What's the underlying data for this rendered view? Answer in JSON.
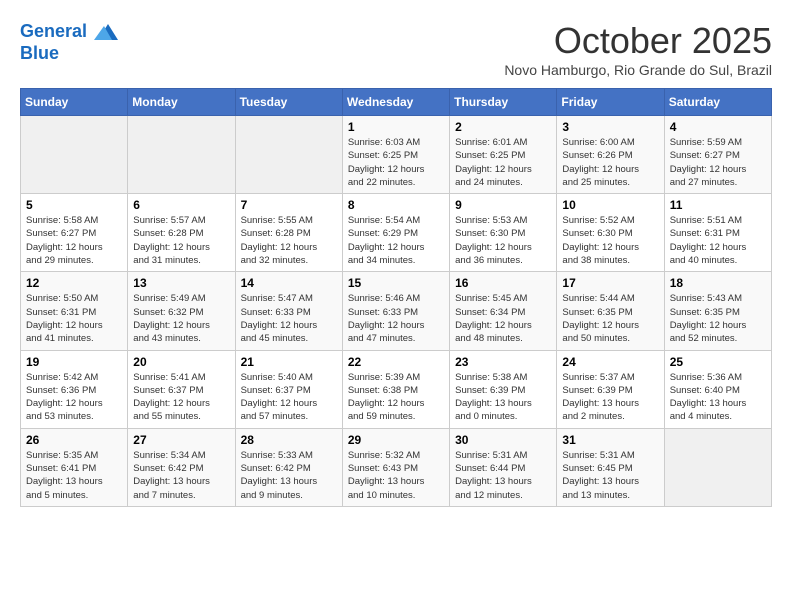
{
  "header": {
    "logo_line1": "General",
    "logo_line2": "Blue",
    "month_title": "October 2025",
    "location": "Novo Hamburgo, Rio Grande do Sul, Brazil"
  },
  "weekdays": [
    "Sunday",
    "Monday",
    "Tuesday",
    "Wednesday",
    "Thursday",
    "Friday",
    "Saturday"
  ],
  "weeks": [
    [
      {
        "day": "",
        "info": ""
      },
      {
        "day": "",
        "info": ""
      },
      {
        "day": "",
        "info": ""
      },
      {
        "day": "1",
        "info": "Sunrise: 6:03 AM\nSunset: 6:25 PM\nDaylight: 12 hours\nand 22 minutes."
      },
      {
        "day": "2",
        "info": "Sunrise: 6:01 AM\nSunset: 6:25 PM\nDaylight: 12 hours\nand 24 minutes."
      },
      {
        "day": "3",
        "info": "Sunrise: 6:00 AM\nSunset: 6:26 PM\nDaylight: 12 hours\nand 25 minutes."
      },
      {
        "day": "4",
        "info": "Sunrise: 5:59 AM\nSunset: 6:27 PM\nDaylight: 12 hours\nand 27 minutes."
      }
    ],
    [
      {
        "day": "5",
        "info": "Sunrise: 5:58 AM\nSunset: 6:27 PM\nDaylight: 12 hours\nand 29 minutes."
      },
      {
        "day": "6",
        "info": "Sunrise: 5:57 AM\nSunset: 6:28 PM\nDaylight: 12 hours\nand 31 minutes."
      },
      {
        "day": "7",
        "info": "Sunrise: 5:55 AM\nSunset: 6:28 PM\nDaylight: 12 hours\nand 32 minutes."
      },
      {
        "day": "8",
        "info": "Sunrise: 5:54 AM\nSunset: 6:29 PM\nDaylight: 12 hours\nand 34 minutes."
      },
      {
        "day": "9",
        "info": "Sunrise: 5:53 AM\nSunset: 6:30 PM\nDaylight: 12 hours\nand 36 minutes."
      },
      {
        "day": "10",
        "info": "Sunrise: 5:52 AM\nSunset: 6:30 PM\nDaylight: 12 hours\nand 38 minutes."
      },
      {
        "day": "11",
        "info": "Sunrise: 5:51 AM\nSunset: 6:31 PM\nDaylight: 12 hours\nand 40 minutes."
      }
    ],
    [
      {
        "day": "12",
        "info": "Sunrise: 5:50 AM\nSunset: 6:31 PM\nDaylight: 12 hours\nand 41 minutes."
      },
      {
        "day": "13",
        "info": "Sunrise: 5:49 AM\nSunset: 6:32 PM\nDaylight: 12 hours\nand 43 minutes."
      },
      {
        "day": "14",
        "info": "Sunrise: 5:47 AM\nSunset: 6:33 PM\nDaylight: 12 hours\nand 45 minutes."
      },
      {
        "day": "15",
        "info": "Sunrise: 5:46 AM\nSunset: 6:33 PM\nDaylight: 12 hours\nand 47 minutes."
      },
      {
        "day": "16",
        "info": "Sunrise: 5:45 AM\nSunset: 6:34 PM\nDaylight: 12 hours\nand 48 minutes."
      },
      {
        "day": "17",
        "info": "Sunrise: 5:44 AM\nSunset: 6:35 PM\nDaylight: 12 hours\nand 50 minutes."
      },
      {
        "day": "18",
        "info": "Sunrise: 5:43 AM\nSunset: 6:35 PM\nDaylight: 12 hours\nand 52 minutes."
      }
    ],
    [
      {
        "day": "19",
        "info": "Sunrise: 5:42 AM\nSunset: 6:36 PM\nDaylight: 12 hours\nand 53 minutes."
      },
      {
        "day": "20",
        "info": "Sunrise: 5:41 AM\nSunset: 6:37 PM\nDaylight: 12 hours\nand 55 minutes."
      },
      {
        "day": "21",
        "info": "Sunrise: 5:40 AM\nSunset: 6:37 PM\nDaylight: 12 hours\nand 57 minutes."
      },
      {
        "day": "22",
        "info": "Sunrise: 5:39 AM\nSunset: 6:38 PM\nDaylight: 12 hours\nand 59 minutes."
      },
      {
        "day": "23",
        "info": "Sunrise: 5:38 AM\nSunset: 6:39 PM\nDaylight: 13 hours\nand 0 minutes."
      },
      {
        "day": "24",
        "info": "Sunrise: 5:37 AM\nSunset: 6:39 PM\nDaylight: 13 hours\nand 2 minutes."
      },
      {
        "day": "25",
        "info": "Sunrise: 5:36 AM\nSunset: 6:40 PM\nDaylight: 13 hours\nand 4 minutes."
      }
    ],
    [
      {
        "day": "26",
        "info": "Sunrise: 5:35 AM\nSunset: 6:41 PM\nDaylight: 13 hours\nand 5 minutes."
      },
      {
        "day": "27",
        "info": "Sunrise: 5:34 AM\nSunset: 6:42 PM\nDaylight: 13 hours\nand 7 minutes."
      },
      {
        "day": "28",
        "info": "Sunrise: 5:33 AM\nSunset: 6:42 PM\nDaylight: 13 hours\nand 9 minutes."
      },
      {
        "day": "29",
        "info": "Sunrise: 5:32 AM\nSunset: 6:43 PM\nDaylight: 13 hours\nand 10 minutes."
      },
      {
        "day": "30",
        "info": "Sunrise: 5:31 AM\nSunset: 6:44 PM\nDaylight: 13 hours\nand 12 minutes."
      },
      {
        "day": "31",
        "info": "Sunrise: 5:31 AM\nSunset: 6:45 PM\nDaylight: 13 hours\nand 13 minutes."
      },
      {
        "day": "",
        "info": ""
      }
    ]
  ]
}
